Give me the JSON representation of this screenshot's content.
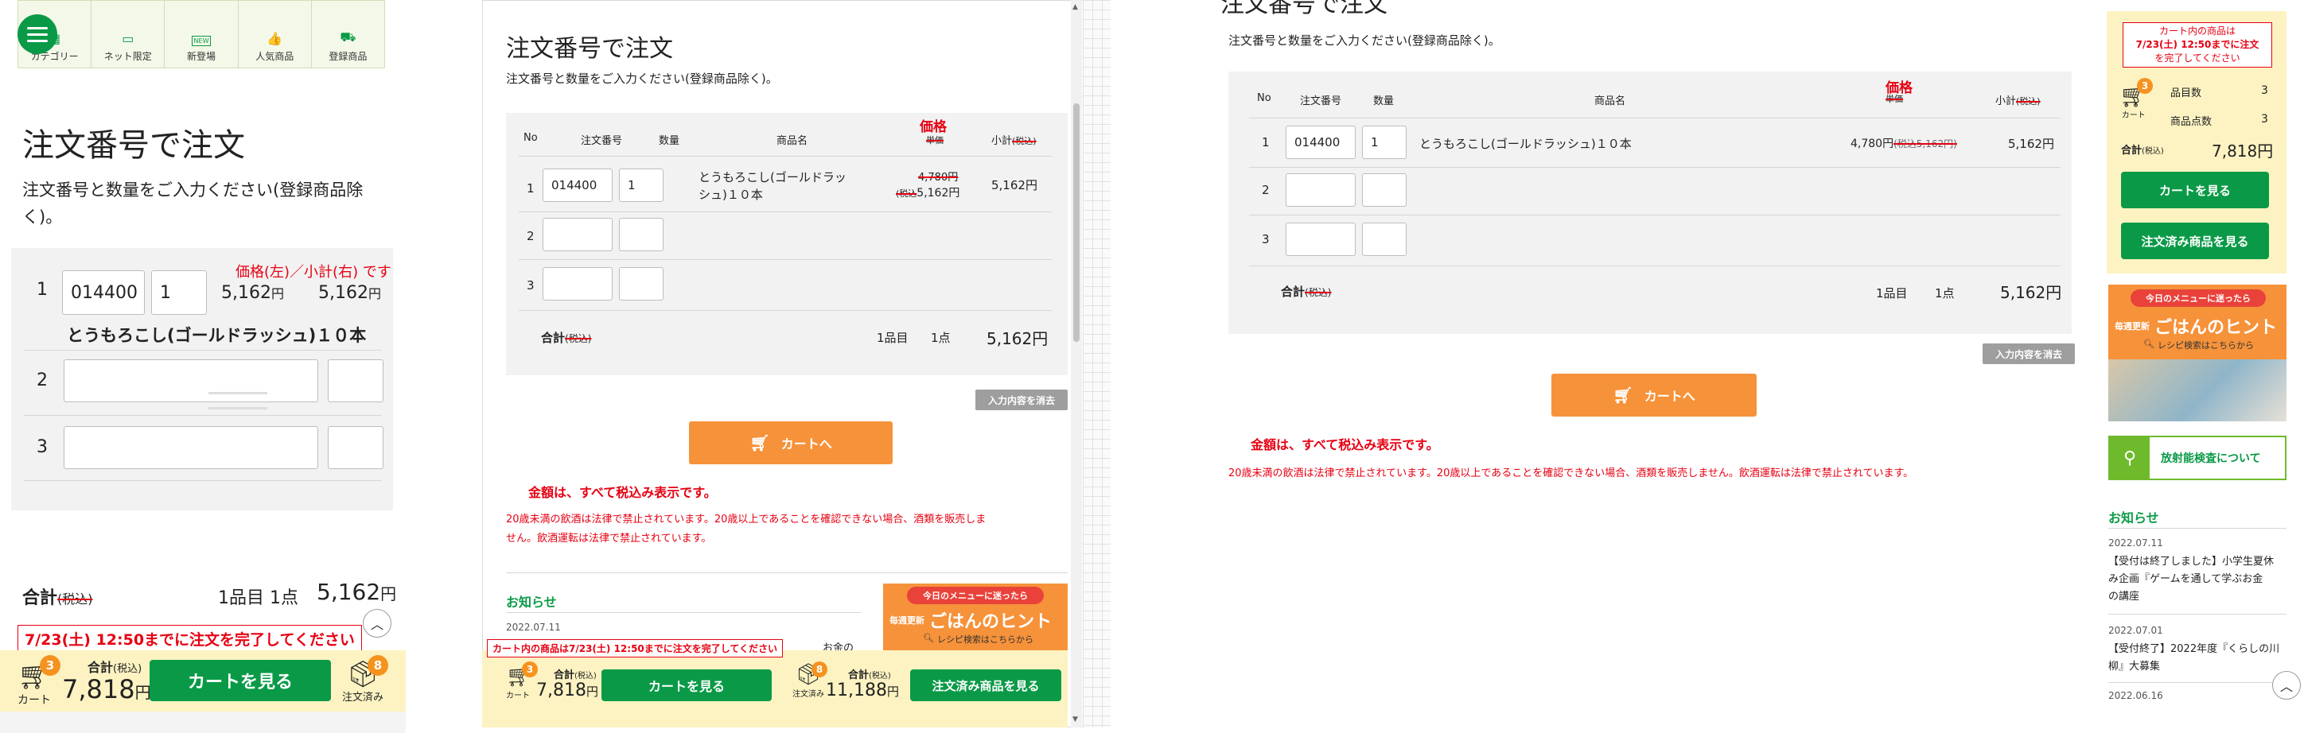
{
  "common": {
    "order_title": "注文番号で注文",
    "instruction": "注文番号と数量をご入力ください(登録商品除く)。",
    "instruction_wrap_a": "注文番号と数量をご入力ください(登録商品除",
    "instruction_wrap_b": "く)。",
    "col_no": "No",
    "col_order_number": "注文番号",
    "col_quantity": "数量",
    "col_product_name": "商品名",
    "col_unit_price": "単価",
    "col_subtotal": "小計",
    "tax_incl_label": "(税込)",
    "price_annotation": "価格",
    "rows": [
      {
        "no": "1",
        "order_number": "014400",
        "quantity": "1",
        "product_name": "とうもろこし(ゴールドラッシュ)１０本",
        "product_name_a": "とうもろこし(ゴールドラッ",
        "product_name_b": "シュ)１０本",
        "unit_price": "4,780円",
        "unit_price_tax_prefix": "(税込",
        "unit_price_tax": "5,162円",
        "unit_price_tax_close": ")",
        "subtotal": "5,162円"
      },
      {
        "no": "2",
        "order_number": "",
        "quantity": ""
      },
      {
        "no": "3",
        "order_number": "",
        "quantity": ""
      }
    ],
    "total_label": "合計",
    "total_tax": "(税込)",
    "total_items": "1品目",
    "total_points": "1点",
    "total_amount": "5,162円",
    "clear_button": "入力内容を消去",
    "add_to_cart_button": "カートへ",
    "notice_amount": "金額は、すべて税込み表示です。",
    "notice_alcohol": "20歳未満の飲酒は法律で禁止されています。20歳以上であることを確認できない場合、酒類を販売しません。飲酒運転は法律で禁止されています。",
    "notice_alcohol_a": "20歳未満の飲酒は法律で禁止されています。20歳以上であることを確認できない場合、酒類を販売しま",
    "notice_alcohol_b": "せん。飲酒運転は法律で禁止されています。",
    "news_title": "お知らせ",
    "cart_label": "カート",
    "cart_badge": "3",
    "cart_total_label": "合計",
    "cart_total_tax": "(税込)",
    "cart_total_amount_num": "7,818",
    "cart_total_yen": "円",
    "view_cart_button": "カートを見る",
    "ordered_label": "注文済み",
    "ordered_badge": "8",
    "ordered_total_amount_num": "11,188",
    "view_ordered_button": "注文済み商品を見る",
    "deadline_notice": "7/23(土) 12:50までに注文を完了してください",
    "deadline_notice_long": "カート内の商品は7/23(土) 12:50までに注文を完了してください"
  },
  "panel1": {
    "nav": [
      {
        "label": "カテゴリー"
      },
      {
        "label": "ネット限定"
      },
      {
        "label": "新登場"
      },
      {
        "label": "人気商品"
      },
      {
        "label": "登録商品"
      }
    ],
    "new_badge": "NEW",
    "price_annotation": "価格(左)／小計(右) です",
    "row1_price": "5,162",
    "row1_subtotal": "5,162",
    "yen": "円",
    "total_amount_num": "5,162",
    "cart_amount_num": "7,818"
  },
  "panel2": {
    "news_date": "2022.07.11",
    "news_tail": "お金の",
    "banner_ribbon": "今日のメニューに迷ったら",
    "banner_small": "毎週更新",
    "banner_big": "ごはんのヒント",
    "banner_search": "レシピ検索はこちらから"
  },
  "panel3": {
    "side_deadline_a": "カート内の商品は",
    "side_deadline_b": "7/23(土) 12:50までに注文",
    "side_deadline_c": "を完了してください",
    "side_items_label": "品目数",
    "side_items_value": "3",
    "side_points_label": "商品点数",
    "side_points_value": "3",
    "side_total_label": "合計",
    "side_total_tax": "(税込)",
    "side_total_value": "7,818円",
    "radiation_banner": "放射能検査について",
    "news": [
      {
        "date": "2022.07.11",
        "lines": [
          "【受付は終了しました】小学生夏休",
          "み企画『ゲームを通して学ぶお金",
          "の講座"
        ]
      },
      {
        "date": "2022.07.01",
        "lines": [
          "【受付終了】2022年度『くらしの川",
          "柳』大募集"
        ]
      },
      {
        "date": "2022.06.16",
        "lines": []
      }
    ]
  },
  "colors": {
    "green": "#0a9a47",
    "orange": "#f6923a",
    "red": "#e60012",
    "yellow": "#fdf3c2"
  }
}
